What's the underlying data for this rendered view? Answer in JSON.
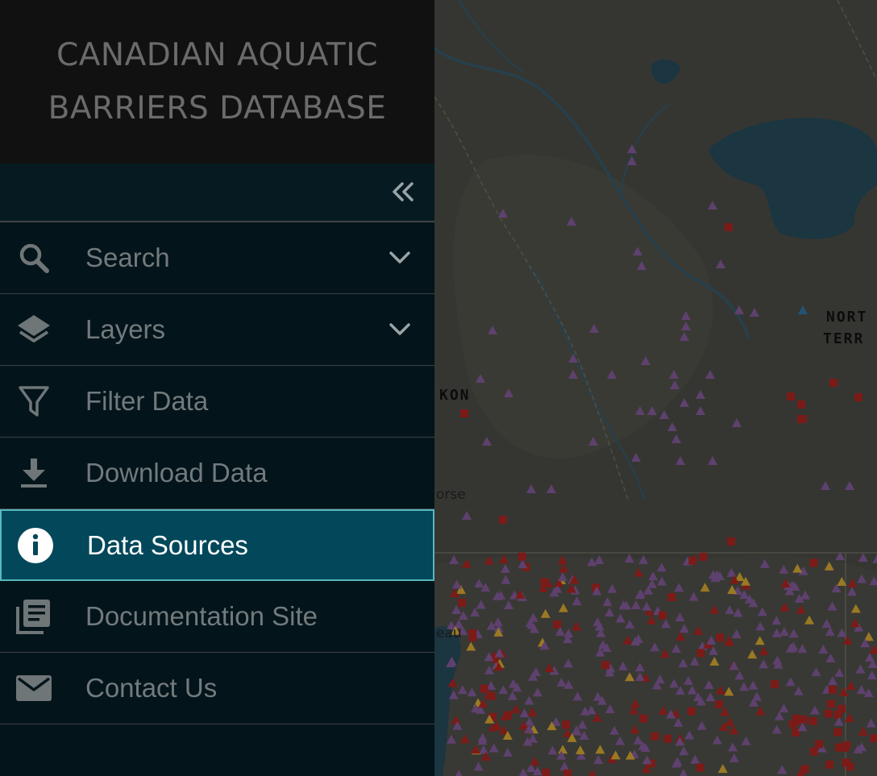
{
  "app": {
    "title": "CANADIAN AQUATIC BARRIERS DATABASE"
  },
  "sidebar": {
    "collapse_icon": "double-chevron-left-icon",
    "items": [
      {
        "label": "Search",
        "icon": "search-icon",
        "expandable": true
      },
      {
        "label": "Layers",
        "icon": "layers-icon",
        "expandable": true
      },
      {
        "label": "Filter Data",
        "icon": "filter-icon",
        "expandable": false
      },
      {
        "label": "Download Data",
        "icon": "download-icon",
        "expandable": false
      },
      {
        "label": "Data Sources",
        "icon": "info-icon",
        "expandable": false,
        "active": true
      },
      {
        "label": "Documentation Site",
        "icon": "documents-icon",
        "expandable": false
      },
      {
        "label": "Contact Us",
        "icon": "mail-icon",
        "expandable": false
      }
    ]
  },
  "map": {
    "labels": {
      "territory_line1": "NORT",
      "territory_line2": "TERR",
      "yukon": "KON",
      "whitehorse": "orse",
      "watson_lake": "eau"
    },
    "marker_colors": {
      "dam": "#6b4a7e",
      "crossing": "#8c1f1c",
      "waterfall": "#b08a2a",
      "other": "#2b5f85"
    }
  },
  "colors": {
    "accent": "#03485a",
    "accent_border": "#58b7c1",
    "sidebar_bg": "#03141a",
    "brand_bg": "#111111"
  }
}
